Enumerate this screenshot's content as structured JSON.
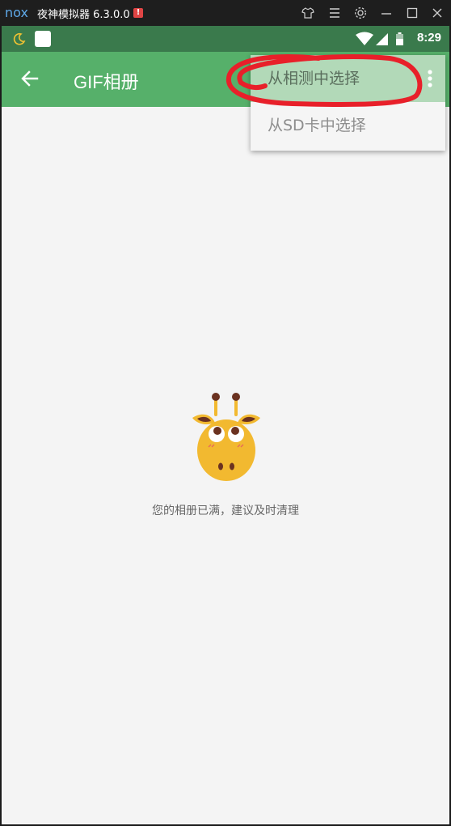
{
  "window": {
    "logo_text": "nox",
    "title": "夜神模拟器 6.3.0.0",
    "warning_badge": "!",
    "controls": [
      "shirt-icon",
      "menu-icon",
      "gear-icon",
      "minimize-icon",
      "maximize-icon",
      "close-icon"
    ]
  },
  "statusbar": {
    "time": "8:29",
    "icons": [
      "moon-icon",
      "app-icon",
      "wifi-icon",
      "signal-icon",
      "battery-icon"
    ]
  },
  "appbar": {
    "title": "GIF相册",
    "back_icon": "arrow-left-icon",
    "more_icon": "more-vertical-icon",
    "color": "#56b06a"
  },
  "menu": {
    "items": [
      {
        "label": "从相测中选择",
        "selected": true
      },
      {
        "label": "从SD卡中选择",
        "selected": false
      }
    ]
  },
  "empty_state": {
    "illustration": "giraffe-icon",
    "message": "您的相册已满，建议及时清理"
  },
  "colors": {
    "status_bar": "#3a7a4c",
    "app_bar": "#56b06a",
    "menu_highlight": "#b2d9b8",
    "annotation": "#e8202a"
  }
}
